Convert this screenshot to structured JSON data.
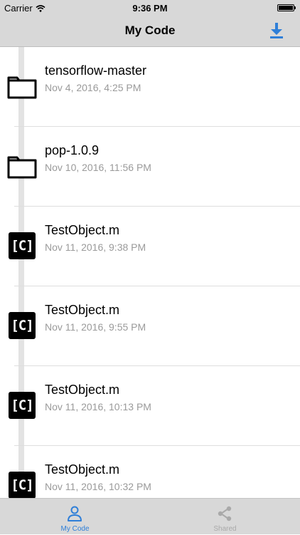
{
  "status_bar": {
    "carrier": "Carrier",
    "time": "9:36 PM"
  },
  "nav": {
    "title": "My Code",
    "download_icon": "download-icon"
  },
  "items": [
    {
      "type": "folder",
      "name": "tensorflow-master",
      "date": "Nov 4, 2016, 4:25 PM"
    },
    {
      "type": "folder",
      "name": "pop-1.0.9",
      "date": "Nov 10, 2016, 11:56 PM"
    },
    {
      "type": "code",
      "icon_text": "[C]",
      "name": "TestObject.m",
      "date": "Nov 11, 2016, 9:38 PM"
    },
    {
      "type": "code",
      "icon_text": "[C]",
      "name": "TestObject.m",
      "date": "Nov 11, 2016, 9:55 PM"
    },
    {
      "type": "code",
      "icon_text": "[C]",
      "name": "TestObject.m",
      "date": "Nov 11, 2016, 10:13 PM"
    },
    {
      "type": "code",
      "icon_text": "[C]",
      "name": "TestObject.m",
      "date": "Nov 11, 2016, 10:32 PM"
    }
  ],
  "tabs": [
    {
      "label": "My Code",
      "icon": "person-icon",
      "active": true
    },
    {
      "label": "Shared",
      "icon": "share-icon",
      "active": false
    }
  ],
  "colors": {
    "accent": "#2f7fd8",
    "inactive": "#a9a9a9",
    "bar_bg": "#d8d8d8",
    "date_text": "#9a9a9a"
  }
}
